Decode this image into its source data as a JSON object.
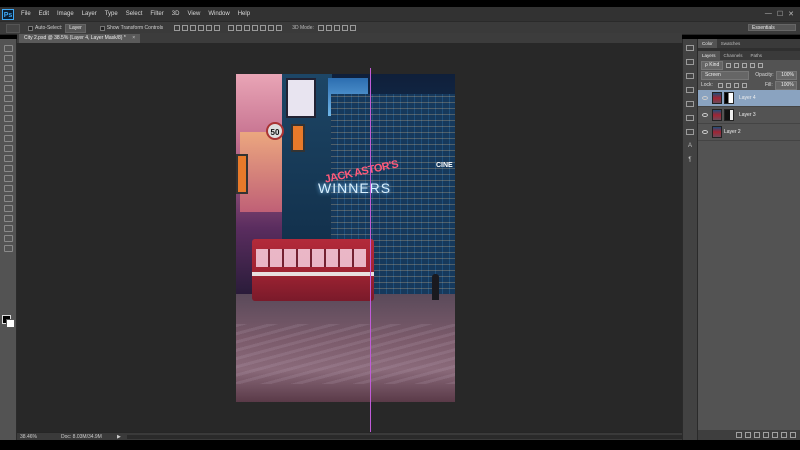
{
  "app": {
    "logo": "Ps"
  },
  "menu": [
    "File",
    "Edit",
    "Image",
    "Layer",
    "Type",
    "Select",
    "Filter",
    "3D",
    "View",
    "Window",
    "Help"
  ],
  "window_controls": [
    "—",
    "☐",
    "✕"
  ],
  "options": {
    "auto_select_label": "Auto-Select:",
    "auto_select_value": "Layer",
    "show_transform_label": "Show Transform Controls",
    "mode_3d_label": "3D Mode:",
    "workspace": "Essentials"
  },
  "document": {
    "tab_title": "City 2.psd @ 38.5% (Layer 4, Layer Mask/8) *",
    "close_glyph": "×"
  },
  "canvas_image": {
    "signs": [
      "JACK ASTOR'S",
      "WINNERS",
      "CINE",
      "50"
    ]
  },
  "status": {
    "zoom": "38.46%",
    "doc": "Doc: 8.03M/34.9M",
    "arrow": "▶"
  },
  "right_dock": {
    "text_tool": "A",
    "para_tool": "¶"
  },
  "panels": {
    "top_tabs": [
      "Color",
      "Swatches"
    ],
    "layer_tabs": [
      "Layers",
      "Channels",
      "Paths"
    ],
    "kind_filter": "ρ Kind",
    "blend_mode": "Screen",
    "opacity_label": "Opacity:",
    "opacity_value": "100%",
    "lock_label": "Lock:",
    "fill_label": "Fill:",
    "fill_value": "100%",
    "layers": [
      {
        "name": "Layer 4",
        "selected": true
      },
      {
        "name": "Layer 3",
        "selected": false
      },
      {
        "name": "Layer 2",
        "selected": false
      }
    ]
  }
}
